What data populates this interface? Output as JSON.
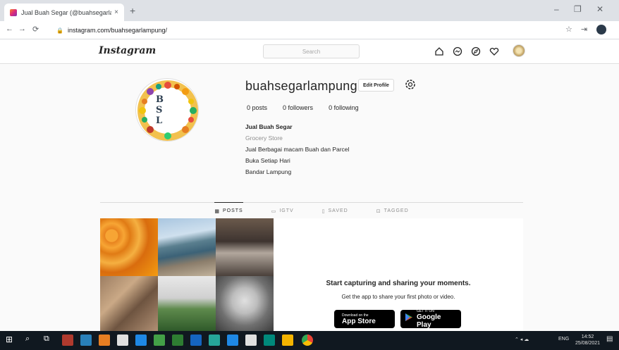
{
  "browser": {
    "tab_title": "Jual Buah Segar (@buahsegarla",
    "tab_close": "×",
    "new_tab": "+",
    "url": "instagram.com/buahsegarlampung/",
    "window_min": "–",
    "window_max": "❐",
    "window_close": "✕"
  },
  "instagram": {
    "logo": "Instagram",
    "search_placeholder": "Search",
    "profile": {
      "username": "buahsegarlampung",
      "edit_profile": "Edit Profile",
      "posts": "0 posts",
      "followers": "0 followers",
      "following": "0 following",
      "name": "Jual Buah Segar",
      "category": "Grocery Store",
      "bio_lines": [
        "Jual Berbagai macam Buah dan Parcel",
        "Buka Setiap Hari",
        "Bandar Lampung"
      ],
      "avatar_letters": [
        "B",
        "S",
        "L"
      ]
    },
    "tabs": [
      {
        "label": "POSTS",
        "icon": "grid-icon"
      },
      {
        "label": "IGTV",
        "icon": "igtv-icon"
      },
      {
        "label": "SAVED",
        "icon": "bookmark-icon"
      },
      {
        "label": "TAGGED",
        "icon": "tag-icon"
      }
    ],
    "empty_state": {
      "heading": "Start capturing and sharing your moments.",
      "subheading": "Get the app to share your first photo or video.",
      "app_store_small": "Download on the",
      "app_store_big": "App Store",
      "google_play_small": "GET IT ON",
      "google_play_big": "Google Play"
    }
  },
  "taskbar": {
    "tray_lang": "ENG",
    "time": "14:52",
    "date": "25/08/2021"
  },
  "colors": {
    "ig_border": "#dbdbdb",
    "ig_bg": "#fafafa",
    "taskbar": "#101820"
  }
}
